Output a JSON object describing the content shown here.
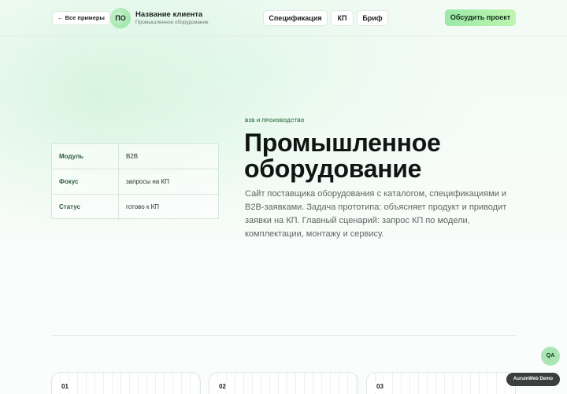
{
  "header": {
    "back_label": "← Все примеры",
    "avatar_initials": "ПО",
    "client_name": "Название клиента",
    "client_subtitle": "Промышленное оборудование",
    "tabs": [
      {
        "label": "Спецификация"
      },
      {
        "label": "КП"
      },
      {
        "label": "Бриф"
      }
    ],
    "cta_label": "Обсудить проект"
  },
  "info_table": {
    "rows": [
      {
        "key": "Модуль",
        "value": "B2B"
      },
      {
        "key": "Фокус",
        "value": "запросы на КП"
      },
      {
        "key": "Статус",
        "value": "готово к КП"
      }
    ]
  },
  "hero": {
    "eyebrow": "B2B И ПРОИЗВОДСТВО",
    "title_line1": "Промышленное",
    "title_line2": "оборудование",
    "description": "Сайт поставщика оборудования с каталогом, спецификациями и B2B-заявками. Задача прототипа: объясняет продукт и приводит заявки на КП. Главный сценарий: запрос КП по модели, комплектации, монтажу и сервису."
  },
  "cards": [
    {
      "number": "01"
    },
    {
      "number": "02"
    },
    {
      "number": "03"
    }
  ],
  "widgets": {
    "qa_label": "QA",
    "demo_label": "AurumWeb Demo"
  },
  "colors": {
    "accent": "#9be8a6",
    "accent_text": "#2f5e3e",
    "badge_dark": "#3b3f3d"
  }
}
